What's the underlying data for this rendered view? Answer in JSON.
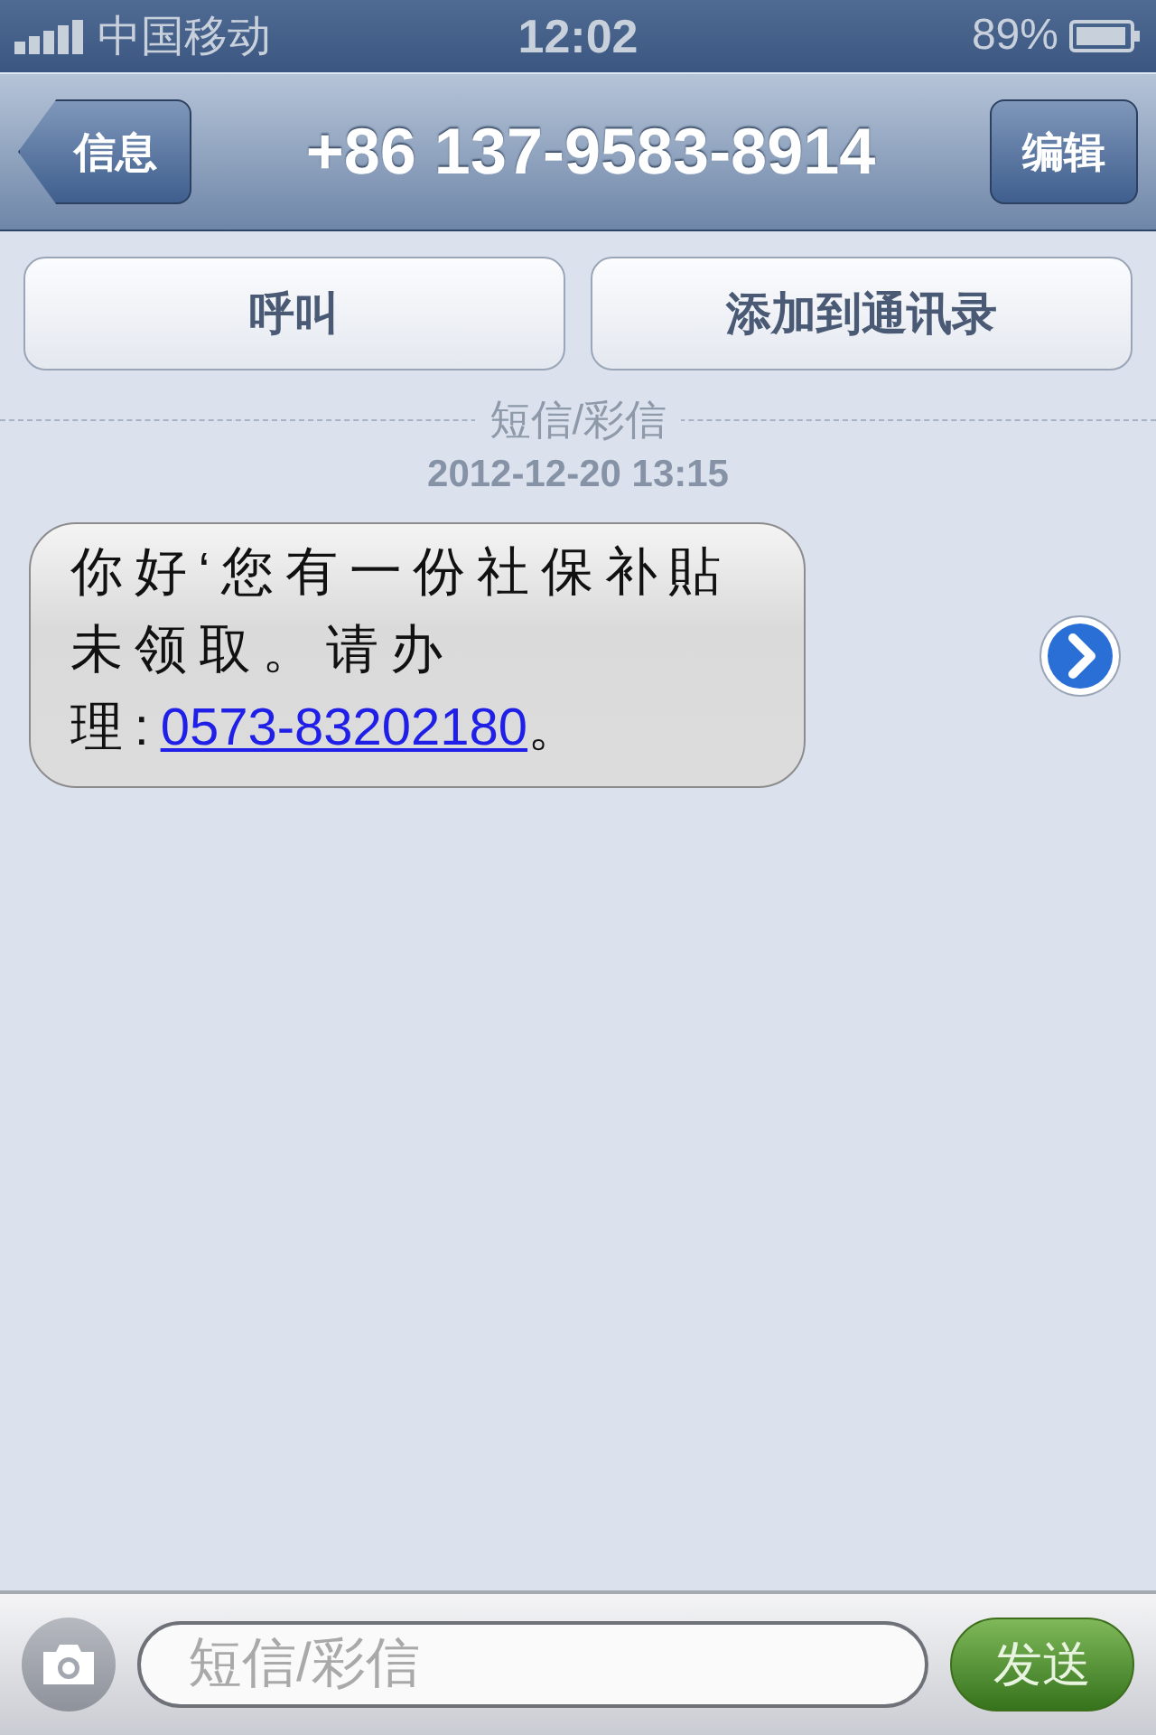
{
  "status_bar": {
    "carrier": "中国移动",
    "time": "12:02",
    "battery": "89%"
  },
  "nav_bar": {
    "back": "信息",
    "title": "+86 137-9583-8914",
    "edit": "编辑"
  },
  "actions": [
    "呼叫",
    "添加到通讯录"
  ],
  "divider_label": "短信/彩信",
  "timestamp": "2012-12-20 13:15",
  "messages": [
    {
      "kind": "incoming",
      "text_before": "你好‘您有一份社保补貼未领取。请办理:",
      "link": "0573-83202180",
      "text_after": "。"
    }
  ],
  "composer": {
    "placeholder": "短信/彩信",
    "send": "发送",
    "send_disabled": true
  }
}
